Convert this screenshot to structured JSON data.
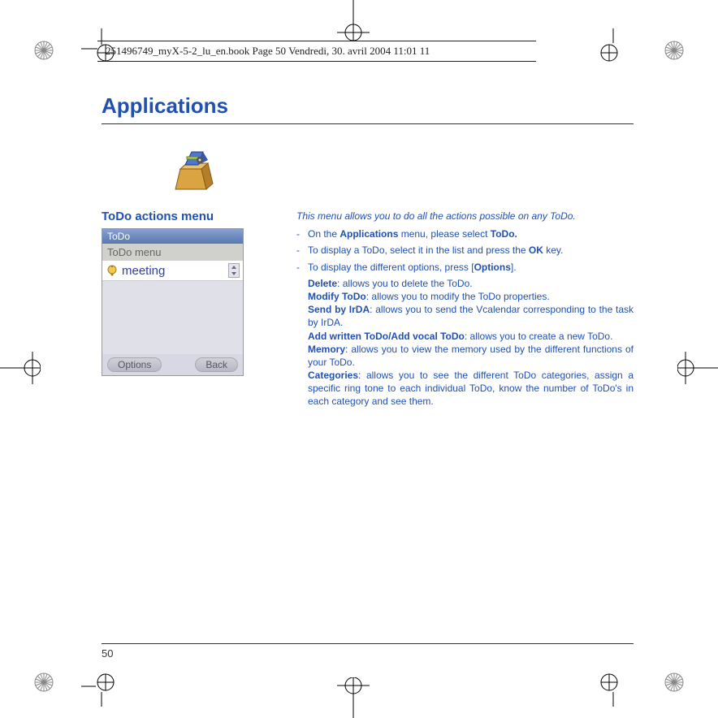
{
  "header": "251496749_myX-5-2_lu_en.book  Page 50  Vendredi, 30. avril 2004  11:01 11",
  "title": "Applications",
  "section_heading": "ToDo actions menu",
  "phone": {
    "titlebar": "ToDo",
    "sub": "ToDo menu",
    "row1": "meeting",
    "softkey_left": "Options",
    "softkey_right": "Back"
  },
  "intro": "This menu allows you to do all the actions possible on any ToDo.",
  "bullet1_pre": "On the ",
  "bullet1_bold1": "Applications",
  "bullet1_mid": " menu, please select ",
  "bullet1_bold2": "ToDo.",
  "bullet2_pre": "To display a ToDo, select it in the list and press the ",
  "bullet2_bold": "OK",
  "bullet2_post": " key.",
  "bullet3_pre": "To display the different options, press [",
  "bullet3_bold": "Options",
  "bullet3_post": "].",
  "opts": {
    "delete_b": "Delete",
    "delete_t": ": allows you to delete the ToDo.",
    "modify_b": "Modify ToDo",
    "modify_t": ": allows you to modify the ToDo properties.",
    "send_b": "Send by IrDA",
    "send_t": ": allows you to send the Vcalendar corresponding to the task by IrDA.",
    "add_b": "Add written ToDo/Add vocal ToDo",
    "add_t": ": allows you to create a new ToDo.",
    "mem_b": "Memory",
    "mem_t": ": allows you to view the memory used by the different functions of your ToDo.",
    "cat_b": "Categories",
    "cat_t": ": allows you to see the different ToDo categories, assign a specific ring tone to each individual ToDo, know the number of ToDo's in each category and see them."
  },
  "page_num": "50"
}
